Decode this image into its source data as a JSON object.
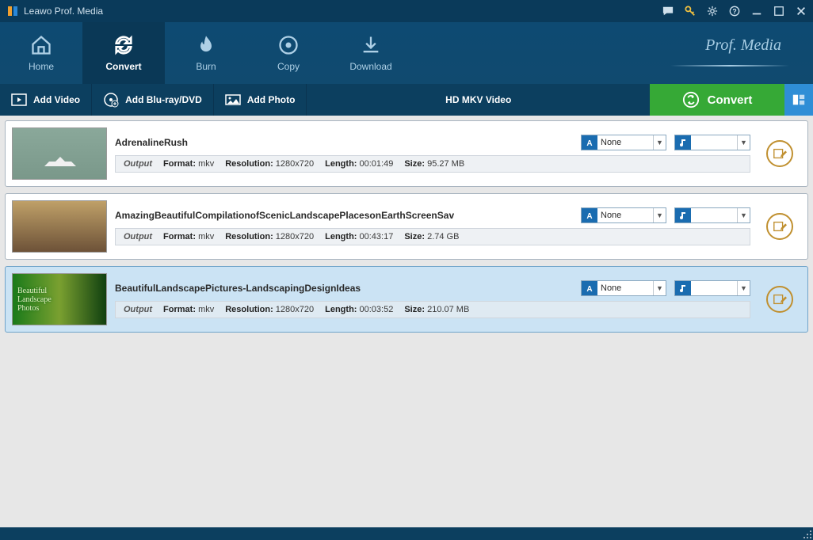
{
  "titlebar": {
    "title": "Leawo Prof. Media"
  },
  "nav": {
    "home": "Home",
    "convert": "Convert",
    "burn": "Burn",
    "copy": "Copy",
    "download": "Download",
    "brand": "Prof. Media"
  },
  "toolbar": {
    "add_video": "Add Video",
    "add_bluray": "Add Blu-ray/DVD",
    "add_photo": "Add Photo",
    "profile": "HD MKV Video",
    "convert_btn": "Convert"
  },
  "labels": {
    "output": "Output",
    "format": "Format:",
    "resolution": "Resolution:",
    "length": "Length:",
    "size": "Size:",
    "subtitle_none": "None"
  },
  "items": [
    {
      "title": "AdrenalineRush",
      "format": "mkv",
      "resolution": "1280x720",
      "length": "00:01:49",
      "size": "95.27 MB",
      "subtitle": "None",
      "audio": "",
      "selected": false,
      "thumb": "t1"
    },
    {
      "title": "AmazingBeautifulCompilationofScenicLandscapePlacesonEarthScreenSav",
      "format": "mkv",
      "resolution": "1280x720",
      "length": "00:43:17",
      "size": "2.74 GB",
      "subtitle": "None",
      "audio": "",
      "selected": false,
      "thumb": "t2"
    },
    {
      "title": "BeautifulLandscapePictures-LandscapingDesignIdeas",
      "format": "mkv",
      "resolution": "1280x720",
      "length": "00:03:52",
      "size": "210.07 MB",
      "subtitle": "None",
      "audio": "",
      "selected": true,
      "thumb": "t3"
    }
  ]
}
